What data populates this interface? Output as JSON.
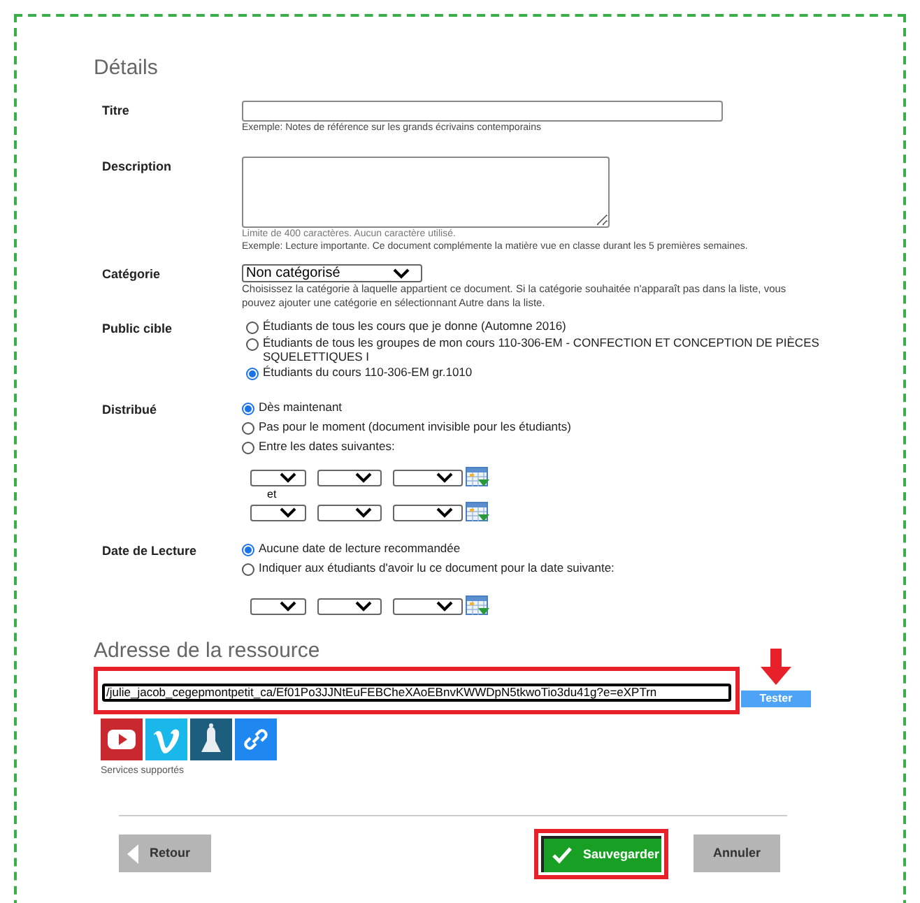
{
  "details": {
    "title": "Détails",
    "title_field": {
      "label": "Titre",
      "help": "Exemple: Notes de référence sur les grands écrivains contemporains"
    },
    "description": {
      "label": "Description",
      "limit_note": "Limite de 400 caractères. Aucun caractère utilisé.",
      "help": "Exemple: Lecture importante. Ce document complémente la matière vue en classe durant les 5 premières semaines."
    },
    "category": {
      "label": "Catégorie",
      "value": "Non catégorisé",
      "help": "Choisissez la catégorie à laquelle appartient ce document. Si la catégorie souhaitée n'apparaît pas dans la liste, vous pouvez ajouter une catégorie en sélectionnant Autre dans la liste."
    },
    "audience": {
      "label": "Public cible",
      "options": [
        {
          "text": "Étudiants de tous les cours que je donne (Automne 2016)",
          "selected": false
        },
        {
          "text": "Étudiants de tous les groupes de mon cours 110-306-EM - CONFECTION ET CONCEPTION DE PIÈCES SQUELETTIQUES I",
          "selected": false
        },
        {
          "text": "Étudiants du cours 110-306-EM gr.1010",
          "selected": true
        }
      ]
    },
    "distribution": {
      "label": "Distribué",
      "options": [
        {
          "text": "Dès maintenant",
          "selected": true
        },
        {
          "text": "Pas pour le moment (document invisible pour les étudiants)",
          "selected": false
        },
        {
          "text": "Entre les dates suivantes:",
          "selected": false
        }
      ],
      "between": "et"
    },
    "reading_date": {
      "label": "Date de Lecture",
      "options": [
        {
          "text": "Aucune date de lecture recommandée",
          "selected": true
        },
        {
          "text": "Indiquer aux étudiants d'avoir lu ce document pour la date suivante:",
          "selected": false
        }
      ]
    }
  },
  "resource": {
    "title": "Adresse de la ressource",
    "url": "/julie_jacob_cegepmontpetit_ca/Ef01Po3JJNtEuFEBCheXAoEBnvKWWDpN5tkwoTio3du41g?e=eXPTrn",
    "url_highlighted": true,
    "test_button": "Tester",
    "test_arrow": true,
    "services": [
      {
        "kind": "youtube"
      },
      {
        "kind": "vimeo"
      },
      {
        "kind": "bell"
      },
      {
        "kind": "link"
      }
    ],
    "services_caption": "Services supportés"
  },
  "buttons": [
    {
      "kind": "back",
      "label": "Retour",
      "highlighted": false
    },
    {
      "kind": "save",
      "label": "Sauvegarder",
      "highlighted": true
    },
    {
      "kind": "cancel",
      "label": "Annuler",
      "highlighted": false
    }
  ]
}
